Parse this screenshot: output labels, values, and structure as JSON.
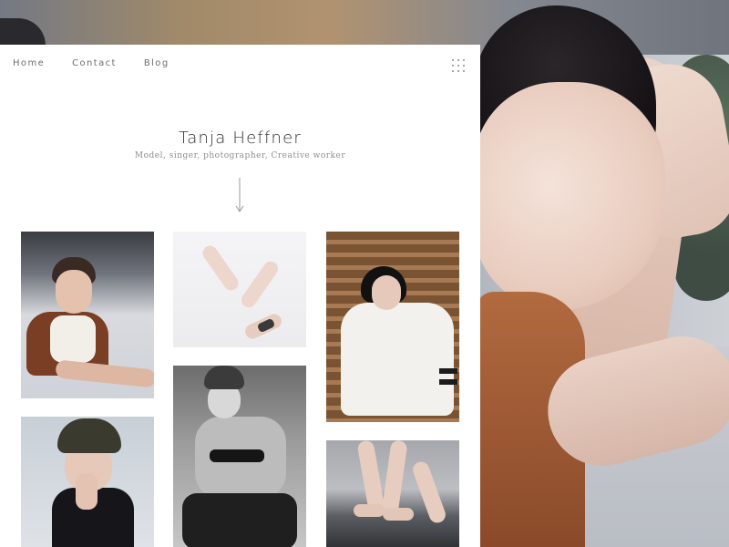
{
  "nav": {
    "items": [
      {
        "label": "Home"
      },
      {
        "label": "Contact"
      },
      {
        "label": "Blog"
      }
    ],
    "menu_icon": "grid-menu-icon"
  },
  "hero": {
    "title": "Tanja Heffner",
    "subtitle": "Model, singer, photographer, Creative worker",
    "arrow_icon": "arrow-down-icon"
  },
  "gallery": {
    "photos": [
      {
        "name": "photo-portrait-jacket"
      },
      {
        "name": "photo-hands"
      },
      {
        "name": "photo-sweater-01"
      },
      {
        "name": "photo-turban-portrait"
      },
      {
        "name": "photo-seated-bw"
      },
      {
        "name": "photo-feet-stones"
      }
    ]
  },
  "colors": {
    "card_bg": "#ffffff",
    "title_text": "#2f2f2f",
    "nav_text": "#6d6d6d",
    "subtitle_text": "#8d8d8d"
  }
}
